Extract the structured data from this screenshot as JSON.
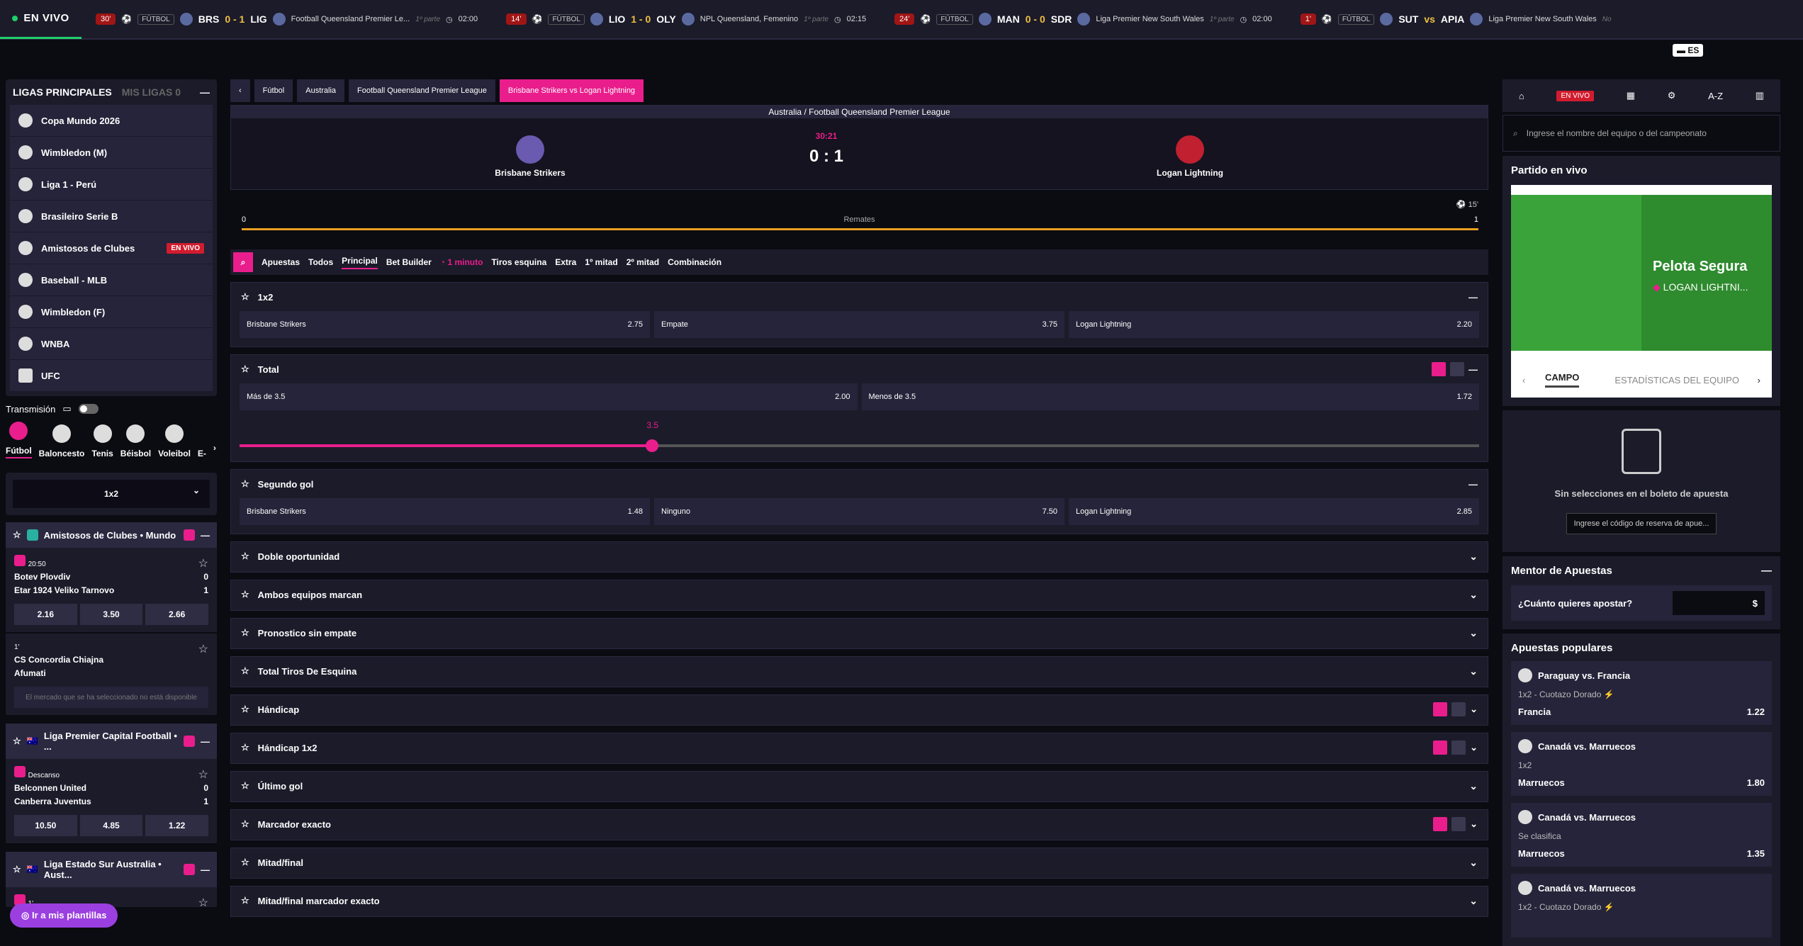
{
  "topbar": {
    "live_label": "EN VIVO",
    "lang": "ES",
    "matches": [
      {
        "minute": "30'",
        "sport": "FÚTBOL",
        "home": "BRS",
        "score": "0 - 1",
        "away": "LIG",
        "league": "Football Queensland Premier Le...",
        "phase": "1º parte",
        "time": "02:00"
      },
      {
        "minute": "14'",
        "sport": "FÚTBOL",
        "home": "LIO",
        "score": "1 - 0",
        "away": "OLY",
        "league": "NPL Queensland, Femenino",
        "phase": "1º parte",
        "time": "02:15"
      },
      {
        "minute": "24'",
        "sport": "FÚTBOL",
        "home": "MAN",
        "score": "0 - 0",
        "away": "SDR",
        "league": "Liga Premier New South Wales",
        "phase": "1º parte",
        "time": "02:00"
      },
      {
        "minute": "1'",
        "sport": "FÚTBOL",
        "home": "SUT",
        "score": "vs",
        "away": "APIA",
        "league": "Liga Premier New South Wales",
        "phase": "No",
        "time": ""
      }
    ]
  },
  "left": {
    "tab_main": "LIGAS PRINCIPALES",
    "tab_mine": "MIS LIGAS",
    "tab_mine_count": "0",
    "leagues": [
      {
        "label": "Copa Mundo 2026",
        "live": ""
      },
      {
        "label": "Wimbledon (M)",
        "live": ""
      },
      {
        "label": "Liga 1 - Perú",
        "live": ""
      },
      {
        "label": "Brasileiro Serie B",
        "live": ""
      },
      {
        "label": "Amistosos de Clubes",
        "live": "EN VIVO"
      },
      {
        "label": "Baseball - MLB",
        "live": ""
      },
      {
        "label": "Wimbledon (F)",
        "live": ""
      },
      {
        "label": "WNBA",
        "live": ""
      },
      {
        "label": "UFC",
        "live": ""
      }
    ],
    "transmission": "Transmisión",
    "sports": [
      "Fútbol",
      "Baloncesto",
      "Tenis",
      "Béisbol",
      "Voleibol",
      "E-"
    ],
    "market_select": "1x2",
    "group1": "Amistosos de Clubes • Mundo",
    "ev1": {
      "time": "20:50",
      "home": "Botev Plovdiv",
      "hs": "0",
      "away": "Etar 1924 Veliko Tarnovo",
      "as": "1",
      "o1": "2.16",
      "o2": "3.50",
      "o3": "2.66"
    },
    "ev2": {
      "time": "1'",
      "home": "CS Concordia Chiajna",
      "away": "Afumati",
      "na": "El mercado que se ha seleccionado no está disponible"
    },
    "group2": "Liga Premier Capital Football • ...",
    "ev3": {
      "time": "Descanso",
      "home": "Belconnen United",
      "hs": "0",
      "away": "Canberra Juventus",
      "as": "1",
      "o1": "10.50",
      "o2": "4.85",
      "o3": "1.22"
    },
    "group3": "Liga Estado Sur Australia • Aust...",
    "ev4_time": "1'",
    "plantillas": "Ir a mis plantillas"
  },
  "center": {
    "crumbs": [
      "Fútbol",
      "Australia",
      "Football Queensland Premier League",
      "Brisbane Strikers  vs  Logan Lightning"
    ],
    "league_title": "Australia / Football Queensland Premier League",
    "home": "Brisbane Strikers",
    "away": "Logan Lightning",
    "clock": "30:21",
    "score": "0 : 1",
    "minute": "15'",
    "stat_label": "Remates",
    "stat_home": "0",
    "stat_away": "1",
    "tabs": [
      "Apuestas",
      "Todos",
      "Principal",
      "Bet Builder",
      "1 minuto",
      "Tiros esquina",
      "Extra",
      "1º mitad",
      "2º mitad",
      "Combinación"
    ],
    "m1x2": {
      "title": "1x2",
      "a": "Brisbane Strikers",
      "av": "2.75",
      "b": "Empate",
      "bv": "3.75",
      "c": "Logan Lightning",
      "cv": "2.20"
    },
    "total": {
      "title": "Total",
      "a": "Más de 3.5",
      "av": "2.00",
      "b": "Menos de 3.5",
      "bv": "1.72",
      "line": "3.5"
    },
    "segundo": {
      "title": "Segundo gol",
      "a": "Brisbane Strikers",
      "av": "1.48",
      "b": "Ninguno",
      "bv": "7.50",
      "c": "Logan Lightning",
      "cv": "2.85"
    },
    "collapsed": [
      "Doble oportunidad",
      "Ambos equipos marcan",
      "Pronostico sin empate",
      "Total Tiros De Esquina",
      "Hándicap",
      "Hándicap 1x2",
      "Último gol",
      "Marcador exacto",
      "Mitad/final",
      "Mitad/final marcador exacto"
    ]
  },
  "right": {
    "nav_live": "EN VIVO",
    "nav_az": "A-Z",
    "search_placeholder": "Ingrese el nombre del equipo o del campeonato",
    "live_title": "Partido en vivo",
    "pitch_label": "Pelota Segura",
    "pitch_team": "LOGAN LIGHTNI...",
    "pitch_tab1": "CAMPO",
    "pitch_tab2": "ESTADÍSTICAS DEL EQUIPO",
    "slip_empty": "Sin selecciones en el boleto de apuesta",
    "slip_code": "Ingrese el código de reserva de apue...",
    "mentor_title": "Mentor de Apuestas",
    "mentor_q": "¿Cuánto quieres apostar?",
    "mentor_cur": "$",
    "popular_title": "Apuestas populares",
    "popular": [
      {
        "match": "Paraguay vs. Francia",
        "market": "1x2 - Cuotazo Dorado",
        "sel": "Francia",
        "odd": "1.22"
      },
      {
        "match": "Canadá vs. Marruecos",
        "market": "1x2",
        "sel": "Marruecos",
        "odd": "1.80"
      },
      {
        "match": "Canadá vs. Marruecos",
        "market": "Se clasifica",
        "sel": "Marruecos",
        "odd": "1.35"
      },
      {
        "match": "Canadá vs. Marruecos",
        "market": "1x2 - Cuotazo Dorado",
        "sel": "",
        "odd": ""
      }
    ]
  }
}
